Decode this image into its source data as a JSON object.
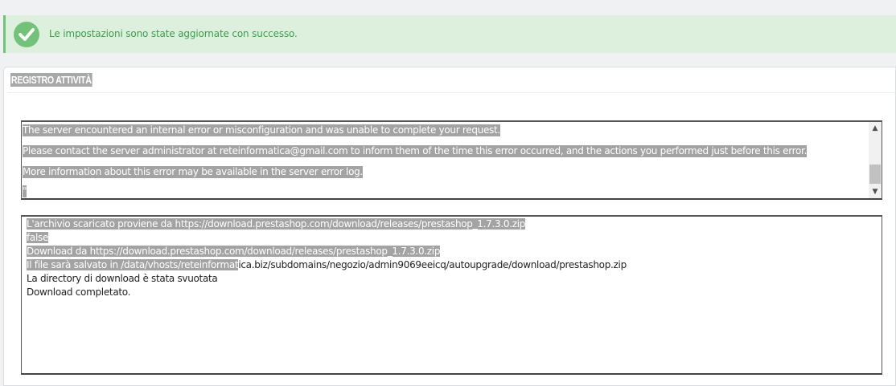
{
  "alert": {
    "message": "Le impostazioni sono state aggiornate con successo.",
    "icon": "check-circle-icon",
    "color": "#72c279"
  },
  "panel": {
    "heading": "REGISTRO ATTIVITÀ"
  },
  "error_box": {
    "lines": [
      "The server encountered an internal error or misconfiguration and was unable to complete your request.",
      "Please contact the server administrator at reteinformatica@gmail.com to inform them of the time this error occurred, and the actions you performed just before this error.",
      "More information about this error may be available in the server error log.",
      "\""
    ]
  },
  "log_box": {
    "lines": [
      {
        "selected": "L'archivio scaricato proviene da https://download.prestashop.com/download/releases/prestashop_1.7.3.0.zip",
        "rest": ""
      },
      {
        "selected": "false",
        "rest": ""
      },
      {
        "selected": "Download da https://download.prestashop.com/download/releases/prestashop_1.7.3.0.zip",
        "rest": ""
      },
      {
        "selected": "Il file sarà salvato in /data/vhosts/reteinformat",
        "rest": "ica.biz/subdomains/negozio/admin9069eeicq/autoupgrade/download/prestashop.zip"
      },
      {
        "selected": "",
        "rest": "La directory di download è stata svuotata"
      },
      {
        "selected": "",
        "rest": "Download completato."
      }
    ]
  }
}
